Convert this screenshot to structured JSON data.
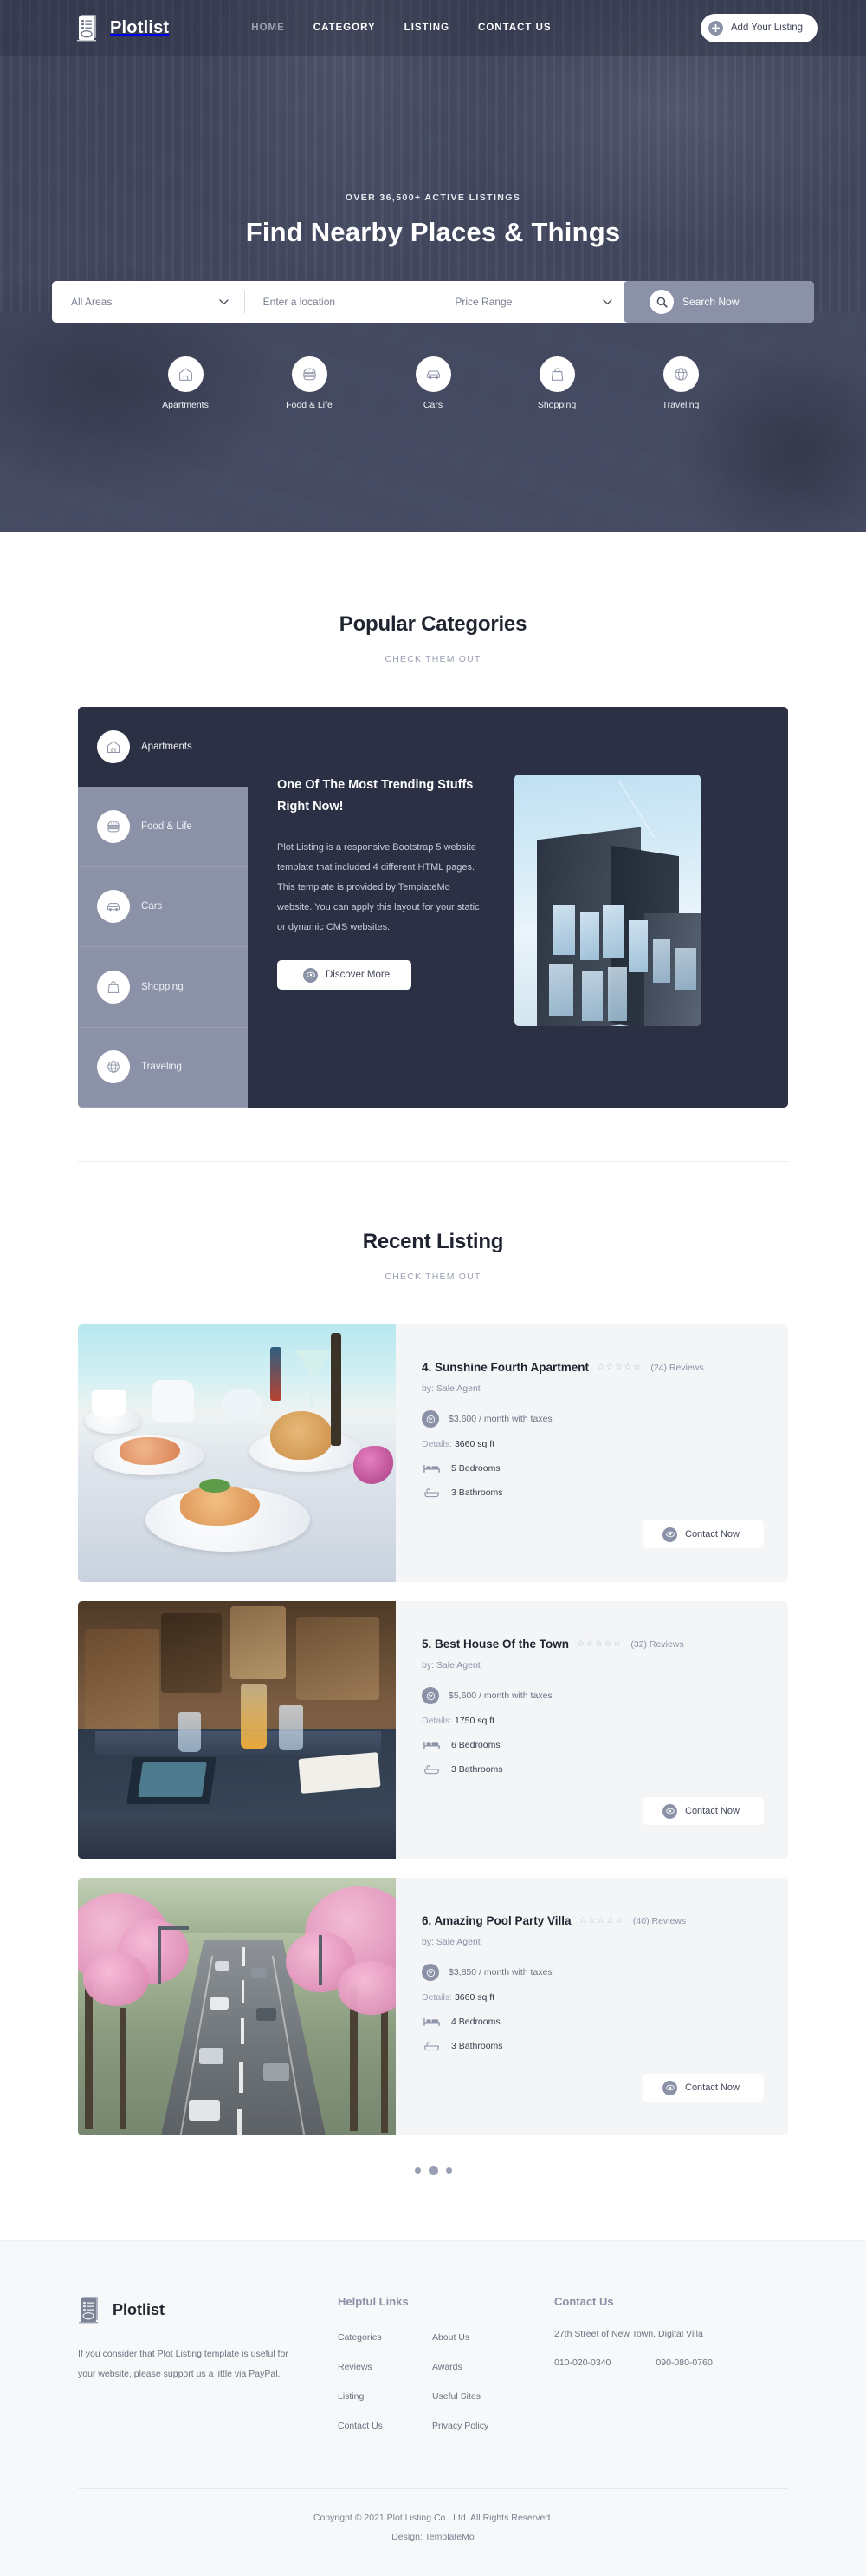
{
  "brand": {
    "name": "Plotlist",
    "logo_icon": "document-list-icon"
  },
  "nav": {
    "items": [
      {
        "label": "HOME",
        "state": "muted"
      },
      {
        "label": "CATEGORY",
        "state": "active"
      },
      {
        "label": "LISTING",
        "state": "active"
      },
      {
        "label": "CONTACT US",
        "state": "active"
      }
    ],
    "cta": {
      "label": "Add Your Listing",
      "icon": "plus-circle-icon"
    }
  },
  "hero": {
    "eyebrow": "OVER 36,500+ ACTIVE LISTINGS",
    "title": "Find Nearby Places & Things",
    "search": {
      "area": {
        "value": "All Areas",
        "chevron": "chevron-down-icon"
      },
      "location": {
        "placeholder": "Enter a location",
        "value": ""
      },
      "price": {
        "value": "Price Range",
        "chevron": "chevron-down-icon"
      },
      "button": {
        "label": "Search Now",
        "icon": "search-icon"
      }
    },
    "categories": [
      {
        "label": "Apartments",
        "icon": "home-icon"
      },
      {
        "label": "Food & Life",
        "icon": "burger-icon"
      },
      {
        "label": "Cars",
        "icon": "car-icon"
      },
      {
        "label": "Shopping",
        "icon": "shopping-bag-icon"
      },
      {
        "label": "Traveling",
        "icon": "globe-icon"
      }
    ]
  },
  "popular": {
    "title": "Popular Categories",
    "subtitle": "CHECK THEM OUT",
    "tabs": [
      {
        "label": "Apartments",
        "icon": "home-icon",
        "active": true
      },
      {
        "label": "Food & Life",
        "icon": "burger-icon",
        "active": false
      },
      {
        "label": "Cars",
        "icon": "car-icon",
        "active": false
      },
      {
        "label": "Shopping",
        "icon": "shopping-bag-icon",
        "active": false
      },
      {
        "label": "Traveling",
        "icon": "globe-icon",
        "active": false
      }
    ],
    "panel": {
      "heading": "One Of The Most Trending Stuffs Right Now!",
      "body": "Plot Listing is a responsive Bootstrap 5 website template that included 4 different HTML pages. This template is provided by TemplateMo website. You can apply this layout for your static or dynamic CMS websites.",
      "button": {
        "label": "Discover More",
        "icon": "eye-icon"
      },
      "image_alt": "modern-apartment-building-photo"
    }
  },
  "recent": {
    "title": "Recent Listing",
    "subtitle": "CHECK THEM OUT",
    "cards": [
      {
        "title": "4. Sunshine Fourth Apartment",
        "stars": "☆☆☆☆☆",
        "reviews": "(24) Reviews",
        "by": "by: Sale Agent",
        "price": "$3,600 / month with taxes",
        "details_label": "Details:",
        "details_value": "3660 sq ft",
        "bedrooms": "5 Bedrooms",
        "bathrooms": "3 Bathrooms",
        "button": {
          "label": "Contact Now",
          "icon": "eye-icon"
        },
        "image_alt": "thai-food-beach-table-photo"
      },
      {
        "title": "5. Best House Of the Town",
        "stars": "☆☆☆☆☆",
        "reviews": "(32) Reviews",
        "by": "by: Sale Agent",
        "price": "$5,600 / month with taxes",
        "details_label": "Details:",
        "details_value": "1750 sq ft",
        "bedrooms": "6 Bedrooms",
        "bathrooms": "3 Bathrooms",
        "button": {
          "label": "Contact Now",
          "icon": "eye-icon"
        },
        "image_alt": "restaurant-table-interior-photo"
      },
      {
        "title": "6. Amazing Pool Party Villa",
        "stars": "☆☆☆☆☆",
        "reviews": "(40) Reviews",
        "by": "by: Sale Agent",
        "price": "$3,850 / month with taxes",
        "details_label": "Details:",
        "details_value": "3660 sq ft",
        "bedrooms": "4 Bedrooms",
        "bathrooms": "3 Bathrooms",
        "button": {
          "label": "Contact Now",
          "icon": "eye-icon"
        },
        "image_alt": "road-with-pink-blossom-trees-photo"
      }
    ],
    "pagination": {
      "dots": 3,
      "active_index": 1
    }
  },
  "footer": {
    "brand": "Plotlist",
    "about": "If you consider that Plot Listing template is useful for your website, please support us a little via PayPal.",
    "helpful": {
      "heading": "Helpful Links",
      "col1": [
        "Categories",
        "Reviews",
        "Listing",
        "Contact Us"
      ],
      "col2": [
        "About Us",
        "Awards",
        "Useful Sites",
        "Privacy Policy"
      ]
    },
    "contact": {
      "heading": "Contact Us",
      "address": "27th Street of New Town, Digital Villa",
      "phone1": "010-020-0340",
      "phone2": "090-080-0760"
    },
    "copyright": "Copyright © 2021 Plot Listing Co., Ltd. All Rights Reserved.",
    "design_prefix": "Design: ",
    "design_link": "TemplateMo"
  },
  "colors": {
    "dark_panel": "#2c3044",
    "accent_grey": "#8b91a6",
    "hero_overlay": "#5b6075",
    "card_bg": "#f4f5f7"
  }
}
